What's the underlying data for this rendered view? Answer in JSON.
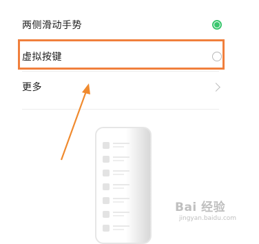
{
  "settings": {
    "items": [
      {
        "label": "两侧滑动手势",
        "control": "radio",
        "selected": true
      },
      {
        "label": "虚拟按键",
        "control": "radio",
        "selected": false
      },
      {
        "label": "更多",
        "control": "chevron"
      }
    ]
  },
  "colors": {
    "accent_green": "#39c66d",
    "highlight_orange": "#f07f3c"
  },
  "watermark": {
    "main": "Bai 经验",
    "sub": "jingyan.baidu.com"
  }
}
